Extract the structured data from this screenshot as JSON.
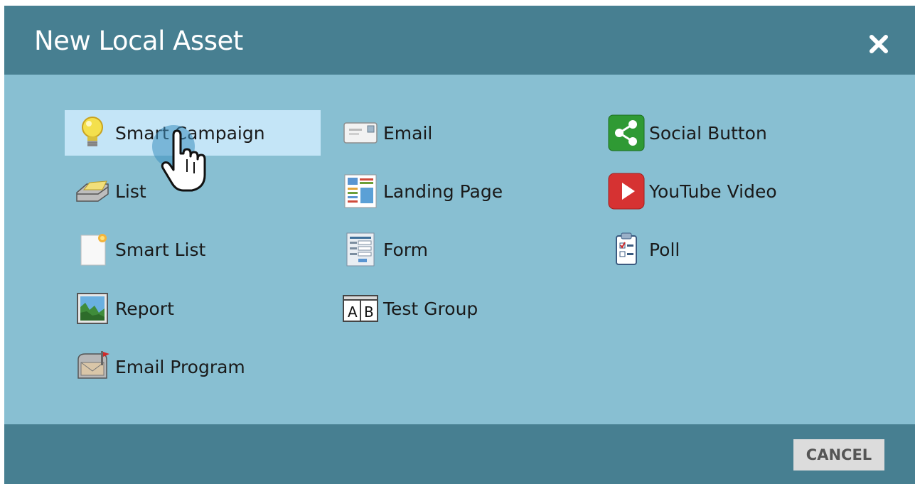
{
  "dialog": {
    "title": "New Local Asset",
    "close_icon": "close-icon",
    "cancel_label": "CANCEL"
  },
  "colors": {
    "header": "#477f91",
    "body": "#88bfd2",
    "selected": "#c4e5f7"
  },
  "columns": [
    [
      {
        "label": "Smart Campaign",
        "icon": "lightbulb-icon",
        "selected": true
      },
      {
        "label": "List",
        "icon": "list-tray-icon"
      },
      {
        "label": "Smart List",
        "icon": "smart-list-icon"
      },
      {
        "label": "Report",
        "icon": "report-chart-icon"
      },
      {
        "label": "Email Program",
        "icon": "mailbox-icon"
      }
    ],
    [
      {
        "label": "Email",
        "icon": "envelope-icon"
      },
      {
        "label": "Landing Page",
        "icon": "landing-page-icon"
      },
      {
        "label": "Form",
        "icon": "form-icon"
      },
      {
        "label": "Test Group",
        "icon": "ab-test-icon"
      }
    ],
    [
      {
        "label": "Social Button",
        "icon": "share-icon"
      },
      {
        "label": "YouTube Video",
        "icon": "youtube-play-icon"
      },
      {
        "label": "Poll",
        "icon": "clipboard-poll-icon"
      }
    ]
  ]
}
